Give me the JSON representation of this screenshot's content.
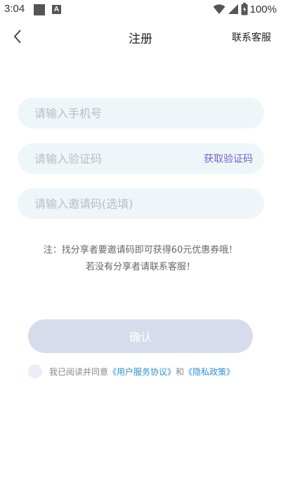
{
  "status_bar": {
    "time": "3:04",
    "battery_text": "100%"
  },
  "header": {
    "title": "注册",
    "contact_label": "联系客服"
  },
  "form": {
    "phone_placeholder": "请输入手机号",
    "phone_value": "",
    "code_placeholder": "请输入验证码",
    "code_value": "",
    "get_code_label": "获取验证码",
    "invite_placeholder": "请输入邀请码(选填)",
    "invite_value": ""
  },
  "note": {
    "line1": "注：找分享者要邀请码即可获得60元优惠券哦！",
    "line2": "若没有分享者请联系客服！"
  },
  "confirm_label": "确认",
  "agreement": {
    "prefix": "我已阅读并同意",
    "user_agreement": "《用户服务协议》",
    "conjunction": "和",
    "privacy_policy": "《隐私政策》"
  },
  "colors": {
    "field_background": "#eef6f9",
    "accent_purple": "#7a5fc8",
    "link_blue": "#2f8fd8",
    "button_disabled": "#d7dcec"
  }
}
